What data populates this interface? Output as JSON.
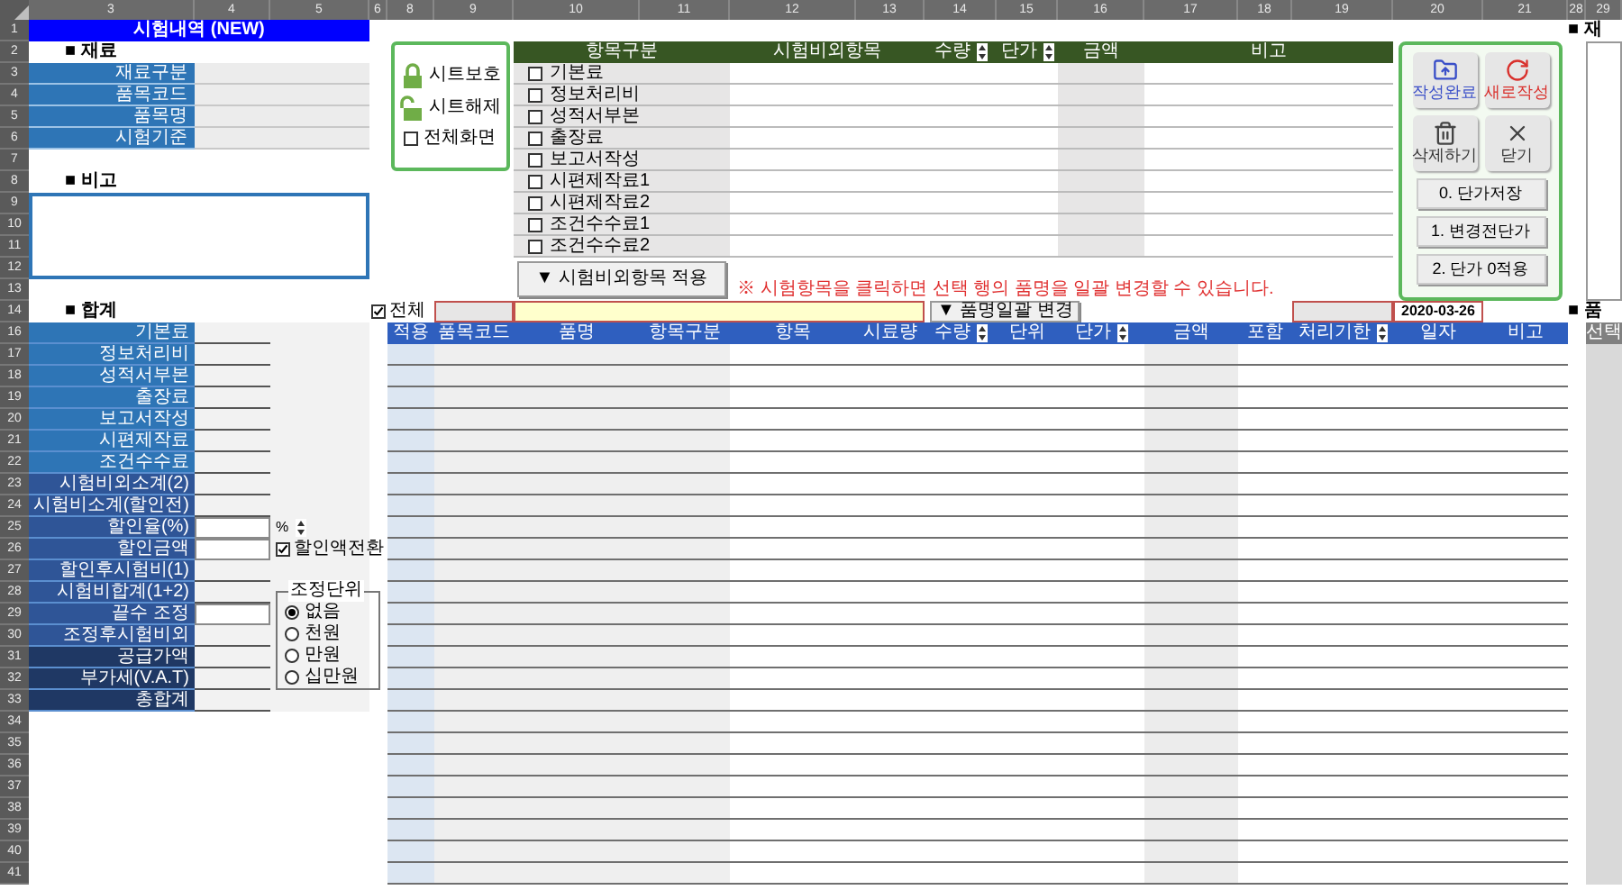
{
  "column_headers": [
    "3",
    "4",
    "5",
    "6",
    "8",
    "9",
    "10",
    "11",
    "12",
    "13",
    "14",
    "15",
    "16",
    "17",
    "18",
    "19",
    "20",
    "21",
    "28",
    "29"
  ],
  "row_numbers": [
    "1",
    "2",
    "3",
    "4",
    "5",
    "6",
    "7",
    "8",
    "9",
    "10",
    "11",
    "12",
    "13",
    "14",
    "16",
    "17",
    "18",
    "19",
    "20",
    "21",
    "22",
    "23",
    "24",
    "25",
    "26",
    "27",
    "28",
    "29",
    "30",
    "31",
    "32",
    "33",
    "34",
    "35",
    "36",
    "37",
    "38",
    "39",
    "40",
    "41"
  ],
  "sheet_title": "시험내역 (NEW)",
  "material": {
    "heading": "■ 재료",
    "fields": [
      {
        "label": "재료구분"
      },
      {
        "label": "품목코드"
      },
      {
        "label": "품목명"
      },
      {
        "label": "시험기준"
      }
    ]
  },
  "remarks": {
    "heading": "■ 비고"
  },
  "totals": {
    "heading": "■ 합계",
    "rows": [
      {
        "label": "기본료",
        "kind": "light",
        "editable": false
      },
      {
        "label": "정보처리비",
        "kind": "light",
        "editable": false
      },
      {
        "label": "성적서부본",
        "kind": "light",
        "editable": false
      },
      {
        "label": "출장료",
        "kind": "light",
        "editable": false
      },
      {
        "label": "보고서작성",
        "kind": "light",
        "editable": false
      },
      {
        "label": "시편제작료",
        "kind": "light",
        "editable": false
      },
      {
        "label": "조건수수료",
        "kind": "light",
        "editable": false
      },
      {
        "label": "시험비외소계(2)",
        "kind": "medium",
        "editable": false
      },
      {
        "label": "시험비소계(할인전)",
        "kind": "medium",
        "editable": false
      },
      {
        "label": "할인율(%)",
        "kind": "medium",
        "editable": true
      },
      {
        "label": "할인금액",
        "kind": "medium",
        "editable": true
      },
      {
        "label": "할인후시험비(1)",
        "kind": "medium",
        "editable": false
      },
      {
        "label": "시험비합계(1+2)",
        "kind": "medium",
        "editable": false
      },
      {
        "label": "끝수 조정",
        "kind": "medium",
        "editable": true
      },
      {
        "label": "조정후시험비외",
        "kind": "medium",
        "editable": false
      },
      {
        "label": "공급가액",
        "kind": "dark",
        "editable": false
      },
      {
        "label": "부가세(V.A.T)",
        "kind": "dark",
        "editable": false
      },
      {
        "label": "총합계",
        "kind": "dark",
        "editable": false
      }
    ]
  },
  "discount_rate_unit": "%",
  "discount_toggle": {
    "label": "할인액전환",
    "checked": true
  },
  "rounding_unit": {
    "title": "조정단위",
    "options": [
      {
        "label": "없음",
        "selected": true
      },
      {
        "label": "천원",
        "selected": false
      },
      {
        "label": "만원",
        "selected": false
      },
      {
        "label": "십만원",
        "selected": false
      }
    ]
  },
  "sheet_controls": {
    "protect": "시트보호",
    "unprotect": "시트해제",
    "fullscreen": {
      "label": "전체화면",
      "checked": false
    }
  },
  "items_table": {
    "columns": [
      {
        "label": "항목구분",
        "spinner": false
      },
      {
        "label": "시험비외항목",
        "spinner": false
      },
      {
        "label": "수량",
        "spinner": true
      },
      {
        "label": "단가",
        "spinner": true
      },
      {
        "label": "금액",
        "spinner": false
      },
      {
        "label": "비고",
        "spinner": false
      }
    ],
    "rows": [
      {
        "label": "기본료",
        "checked": false
      },
      {
        "label": "정보처리비",
        "checked": false
      },
      {
        "label": "성적서부본",
        "checked": false
      },
      {
        "label": "출장료",
        "checked": false
      },
      {
        "label": "보고서작성",
        "checked": false
      },
      {
        "label": "시편제작료1",
        "checked": false
      },
      {
        "label": "시편제작료2",
        "checked": false
      },
      {
        "label": "조건수수료1",
        "checked": false
      },
      {
        "label": "조건수수료2",
        "checked": false
      }
    ]
  },
  "apply_button": "▼ 시험비외항목 적용",
  "note": "※ 시험항목을 클릭하면 선택 행의 품명을 일괄 변경할 수 있습니다.",
  "select_all": {
    "label": "전체",
    "checked": true
  },
  "bulk_rename_button": "▼ 품명일괄 변경",
  "date": "2020-03-26",
  "main_table": {
    "columns": [
      {
        "label": "적용",
        "spinner": false
      },
      {
        "label": "품목코드",
        "spinner": false
      },
      {
        "label": "품명",
        "spinner": false
      },
      {
        "label": "항목구분",
        "spinner": false
      },
      {
        "label": "항목",
        "spinner": false
      },
      {
        "label": "시료량",
        "spinner": false
      },
      {
        "label": "수량",
        "spinner": true
      },
      {
        "label": "단위",
        "spinner": false
      },
      {
        "label": "단가",
        "spinner": true
      },
      {
        "label": "금액",
        "spinner": false
      },
      {
        "label": "포함",
        "spinner": false
      },
      {
        "label": "처리기한",
        "spinner": true
      },
      {
        "label": "일자",
        "spinner": false
      },
      {
        "label": "비고",
        "spinner": false
      }
    ]
  },
  "actions": [
    {
      "label": "작성완료",
      "kind": "complete"
    },
    {
      "label": "새로작성",
      "kind": "new"
    },
    {
      "label": "삭제하기",
      "kind": "delete"
    },
    {
      "label": "닫기",
      "kind": "close"
    }
  ],
  "price_buttons": [
    "0. 단가저장",
    "1. 변경전단가",
    "2. 단가 0적용"
  ],
  "side_panel": {
    "heading_1": "■ 재",
    "heading_2": "■ 품",
    "column": "선택"
  }
}
